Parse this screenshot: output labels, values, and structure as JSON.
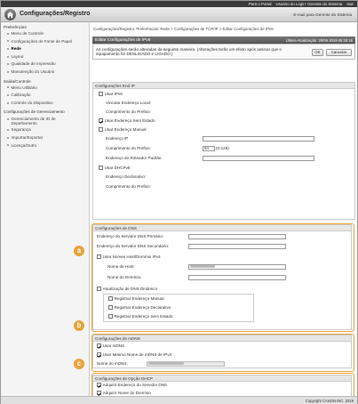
{
  "topbar": {
    "portal": "Para o Portal",
    "user": "Usuário do Login: Gerente do Sistema",
    "logout": "Sair"
  },
  "header": {
    "title": "Configurações/Registro",
    "mail": "E-mail para Gerente do Sistema"
  },
  "sidebar": {
    "groups": [
      {
        "label": "Preferências",
        "items": [
          "Menu de Controle",
          "Configurações de Fonte de Papel",
          "Rede",
          "Layout",
          "Qualidade de Impressão",
          "Manutenção do Usuário"
        ]
      },
      {
        "label": "Saída/Controle",
        "items": [
          "Menu Utilitário",
          "Calibração",
          "Controle do Dispositivo"
        ]
      },
      {
        "label": "Configurações de Gerenciamento",
        "items": [
          "Gerenciamento de ID de Departamento",
          "Segurança",
          "Importar/Exportar",
          "Licença/Outro"
        ]
      }
    ],
    "active": "Rede"
  },
  "breadcrumb": "Configurações/Registro: Preferências: Rede > Configurações de TCP/IP > Editar Configurações de IPv6",
  "panel": {
    "title": "Editar Configurações de IPv6",
    "updated": "Última Atualização :20/06 2019 05:25:16",
    "notice": "As configurações serão alteradas da seguinte maneira. (Alterações terão um efeito após assinar que o equipamento for DESLIGADO e LIGADO.)",
    "ok": "OK",
    "cancel": "Cancelar"
  },
  "ipv6": {
    "header": "Configurações End IP",
    "use_ipv6": "Usar IPv6",
    "link_local": "Vincular Endereço Local:",
    "prefix_len": "Comprimento do Prefixo:",
    "stateless": "Usar Endereço Sem Estado",
    "manual": "Usar Endereço Manual",
    "ip_address": "Endereço IP",
    "prefix_length": "Comprimento do Prefixo:",
    "prefix_value": "64",
    "prefix_range": "(0-128)",
    "default_router": "Endereço do Roteador Padrão:",
    "dhcpv6": "Usar DHCPv6",
    "declared": "Endereço Declarativo:",
    "prefix_len2": "Comprimento do Prefixo:"
  },
  "dns": {
    "header": "Configurações de DNS",
    "primary": "Endereço do Servidor DNS Primário:",
    "secondary": "Endereço do Servidor DNS Secundário:",
    "same_host": "Usar Nomes Host/Domínio IPv4",
    "host_name": "Nome de Host:",
    "domain_name": "Nome do Domínio:",
    "dynamic": "Atualização de DNS Dinâmico",
    "reg_manual": "Registrar Endereço Manual",
    "reg_declared": "Registrar Endereço Declarativo",
    "reg_stateless": "Registrar Endereço Sem Estado"
  },
  "mdns": {
    "header": "Configurações de mDNS",
    "use_mdns": "Usar mDNS",
    "same_name": "Usar Mesmo Nome de mDNS de IPv4",
    "mdns_name": "Nome do mDNS:"
  },
  "dhcp": {
    "header": "Configurações de Opção DHCP",
    "acquire_dns": "Adquirir Endereço do Servidor DNS",
    "acquire_domain": "Adquirir Nome do Domínio"
  },
  "markers": {
    "a": "a",
    "b": "b",
    "c": "c"
  },
  "footer": "Copyright CANON INC. 2019",
  "colors": {
    "accent": "#e8a33a",
    "title_bar": "#555555"
  }
}
